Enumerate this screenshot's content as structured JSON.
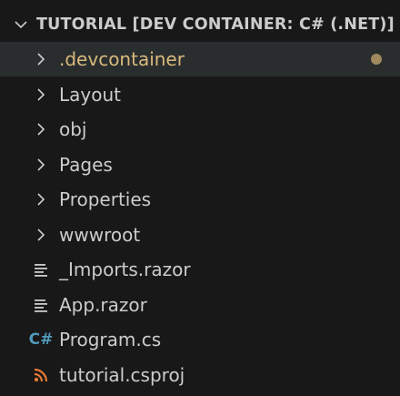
{
  "explorer": {
    "root_title": "TUTORIAL [DEV CONTAINER: C# (.NET)]",
    "items": [
      {
        "label": ".devcontainer",
        "kind": "folder",
        "modified": true
      },
      {
        "label": "Layout",
        "kind": "folder"
      },
      {
        "label": "obj",
        "kind": "folder"
      },
      {
        "label": "Pages",
        "kind": "folder"
      },
      {
        "label": "Properties",
        "kind": "folder"
      },
      {
        "label": "wwwroot",
        "kind": "folder"
      },
      {
        "label": "_Imports.razor",
        "kind": "file",
        "icon": "lines-icon"
      },
      {
        "label": "App.razor",
        "kind": "file",
        "icon": "lines-icon"
      },
      {
        "label": "Program.cs",
        "kind": "file",
        "icon": "csharp-icon",
        "icon_text": "C#"
      },
      {
        "label": "tutorial.csproj",
        "kind": "file",
        "icon": "rss-icon"
      }
    ]
  },
  "colors": {
    "background": "#181818",
    "selected_row": "#2a2d2e",
    "text": "#cccccc",
    "modified_text": "#d7ba7d",
    "modified_dot": "#9e8a5e",
    "csharp_icon": "#519aba",
    "rss_icon": "#e37933"
  }
}
